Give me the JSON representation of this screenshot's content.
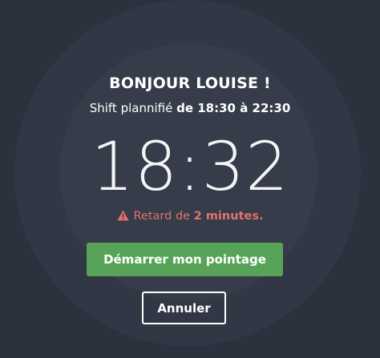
{
  "greeting": "BONJOUR LOUISE !",
  "shift": {
    "prefix": "Shift plannifié",
    "range": "de 18:30 à 22:30"
  },
  "clock": {
    "time": "18:32"
  },
  "delay": {
    "icon": "warning-icon",
    "prefix": "Retard de",
    "amount": "2 minutes."
  },
  "buttons": {
    "start_label": "Démarrer mon pointage",
    "cancel_label": "Annuler"
  },
  "colors": {
    "background": "#2b313d",
    "accent_green": "#57a459",
    "warning": "#e0736a"
  }
}
